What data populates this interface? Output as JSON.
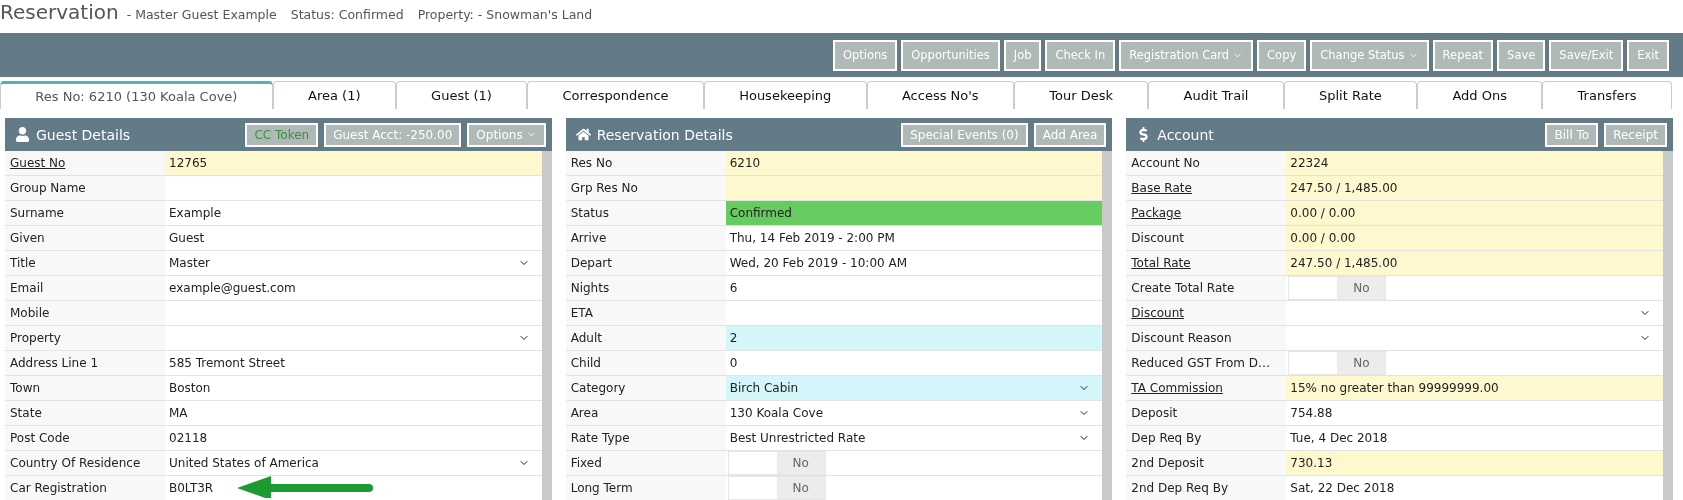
{
  "header": {
    "title": "Reservation",
    "guest": "- Master Guest Example",
    "status": "Status: Confirmed",
    "property": "Property: - Snowman's Land"
  },
  "toolbar": [
    {
      "label": "Options",
      "dropdown": false
    },
    {
      "label": "Opportunities",
      "dropdown": false
    },
    {
      "label": "Job",
      "dropdown": false
    },
    {
      "label": "Check In",
      "dropdown": false
    },
    {
      "label": "Registration Card",
      "dropdown": true
    },
    {
      "label": "Copy",
      "dropdown": false
    },
    {
      "label": "Change Status",
      "dropdown": true
    },
    {
      "label": "Repeat",
      "dropdown": false
    },
    {
      "label": "Save",
      "dropdown": false
    },
    {
      "label": "Save/Exit",
      "dropdown": false
    },
    {
      "label": "Exit",
      "dropdown": false
    }
  ],
  "tabs": [
    {
      "label": "Res No: 6210 (130 Koala Cove)",
      "selected": true
    },
    {
      "label": "Area (1)",
      "selected": false
    },
    {
      "label": "Guest (1)",
      "selected": false
    },
    {
      "label": "Correspondence",
      "selected": false
    },
    {
      "label": "Housekeeping",
      "selected": false
    },
    {
      "label": "Access No's",
      "selected": false
    },
    {
      "label": "Tour Desk",
      "selected": false
    },
    {
      "label": "Audit Trail",
      "selected": false
    },
    {
      "label": "Split Rate",
      "selected": false
    },
    {
      "label": "Add Ons",
      "selected": false
    },
    {
      "label": "Transfers",
      "selected": false
    }
  ],
  "panels": [
    {
      "kind": "guest",
      "title": "Guest Details",
      "buttons": [
        {
          "label": "CC Token",
          "dropdown": false,
          "color": "#3f8f3f"
        },
        {
          "label": "Guest Acct: -250.00",
          "dropdown": false,
          "color": "#ffffff"
        },
        {
          "label": "Options",
          "dropdown": true,
          "color": "#ffffff"
        }
      ],
      "rows": [
        {
          "label": "Guest No",
          "link": true,
          "kind": "text",
          "value": "12765",
          "color": "#fef8cf"
        },
        {
          "label": "Group Name",
          "link": false,
          "kind": "text"
        },
        {
          "label": "Surname",
          "link": false,
          "kind": "text",
          "value": "Example"
        },
        {
          "label": "Given",
          "link": false,
          "kind": "text",
          "value": "Guest"
        },
        {
          "label": "Title",
          "link": false,
          "kind": "select",
          "value": "Master"
        },
        {
          "label": "Email",
          "link": false,
          "kind": "text",
          "value": "example@guest.com"
        },
        {
          "label": "Mobile",
          "link": false,
          "kind": "text"
        },
        {
          "label": "Property",
          "link": false,
          "kind": "select"
        },
        {
          "label": "Address Line 1",
          "link": false,
          "kind": "text",
          "value": "585 Tremont Street"
        },
        {
          "label": "Town",
          "link": false,
          "kind": "text",
          "value": "Boston"
        },
        {
          "label": "State",
          "link": false,
          "kind": "text",
          "value": "MA"
        },
        {
          "label": "Post Code",
          "link": false,
          "kind": "text",
          "value": "02118"
        },
        {
          "label": "Country Of Residence",
          "link": false,
          "kind": "select",
          "value": "United States of America"
        },
        {
          "label": "Car Registration",
          "link": false,
          "kind": "text",
          "value": "B0LT3R",
          "pointer": true
        }
      ]
    },
    {
      "kind": "reservation",
      "title": "Reservation Details",
      "buttons": [
        {
          "label": "Special Events (0)",
          "dropdown": false,
          "color": "#ffffff"
        },
        {
          "label": "Add Area",
          "dropdown": false,
          "color": "#ffffff"
        }
      ],
      "rows": [
        {
          "label": "Res No",
          "link": false,
          "kind": "text",
          "value": "6210",
          "color": "#fef8cf"
        },
        {
          "label": "Grp Res No",
          "link": false,
          "kind": "text",
          "color": "#fef8cf"
        },
        {
          "label": "Status",
          "link": false,
          "kind": "text",
          "value": "Confirmed",
          "color": "#66cc60"
        },
        {
          "label": "Arrive",
          "link": false,
          "kind": "text",
          "value": "Thu, 14 Feb 2019 - 2:00 PM"
        },
        {
          "label": "Depart",
          "link": false,
          "kind": "text",
          "value": "Wed, 20 Feb 2019 - 10:00 AM"
        },
        {
          "label": "Nights",
          "link": false,
          "kind": "text",
          "value": "6"
        },
        {
          "label": "ETA",
          "link": false,
          "kind": "text"
        },
        {
          "label": "Adult",
          "link": false,
          "kind": "text",
          "value": "2",
          "color": "#d2f6f9"
        },
        {
          "label": "Child",
          "link": false,
          "kind": "text",
          "value": "0"
        },
        {
          "label": "Category",
          "link": false,
          "kind": "select",
          "value": "Birch Cabin",
          "color": "#d2f6f9"
        },
        {
          "label": "Area",
          "link": false,
          "kind": "select",
          "value": "130 Koala Cove"
        },
        {
          "label": "Rate Type",
          "link": false,
          "kind": "select",
          "value": "Best Unrestricted Rate"
        },
        {
          "label": "Fixed",
          "link": false,
          "kind": "toggle",
          "value": "No",
          "on": false
        },
        {
          "label": "Long Term",
          "link": false,
          "kind": "toggle",
          "value": "No",
          "on": false
        }
      ]
    },
    {
      "kind": "account",
      "title": "Account",
      "buttons": [
        {
          "label": "Bill To",
          "dropdown": false,
          "color": "#ffffff"
        },
        {
          "label": "Receipt",
          "dropdown": false,
          "color": "#ffffff"
        }
      ],
      "rows": [
        {
          "label": "Account No",
          "link": false,
          "kind": "text",
          "value": "22324",
          "color": "#fef8cf"
        },
        {
          "label": "Base Rate",
          "link": true,
          "kind": "text",
          "value": "247.50 / 1,485.00",
          "color": "#fef8cf"
        },
        {
          "label": "Package",
          "link": true,
          "kind": "text",
          "value": "0.00 / 0.00",
          "color": "#fef8cf"
        },
        {
          "label": "Discount",
          "link": false,
          "kind": "text",
          "value": "0.00 / 0.00",
          "color": "#fef8cf"
        },
        {
          "label": "Total Rate",
          "link": true,
          "kind": "text",
          "value": "247.50 / 1,485.00",
          "color": "#fef8cf"
        },
        {
          "label": "Create Total Rate",
          "link": false,
          "kind": "toggle",
          "value": "No",
          "on": false
        },
        {
          "label": "Discount",
          "link": true,
          "kind": "select"
        },
        {
          "label": "Discount Reason",
          "link": false,
          "kind": "select"
        },
        {
          "label": "Reduced GST From D…",
          "link": false,
          "kind": "toggle",
          "value": "No",
          "on": false
        },
        {
          "label": "TA Commission",
          "link": true,
          "kind": "text",
          "value": "15% no greater than 99999999.00",
          "color": "#fef8cf"
        },
        {
          "label": "Deposit",
          "link": false,
          "kind": "text",
          "value": "754.88"
        },
        {
          "label": "Dep Req By",
          "link": false,
          "kind": "text",
          "value": "Tue, 4 Dec 2018"
        },
        {
          "label": "2nd Deposit",
          "link": false,
          "kind": "text",
          "value": "730.13",
          "color": "#fef8cf"
        },
        {
          "label": "2nd Dep Req By",
          "link": false,
          "kind": "text",
          "value": "Sat, 22 Dec 2018"
        }
      ]
    }
  ]
}
